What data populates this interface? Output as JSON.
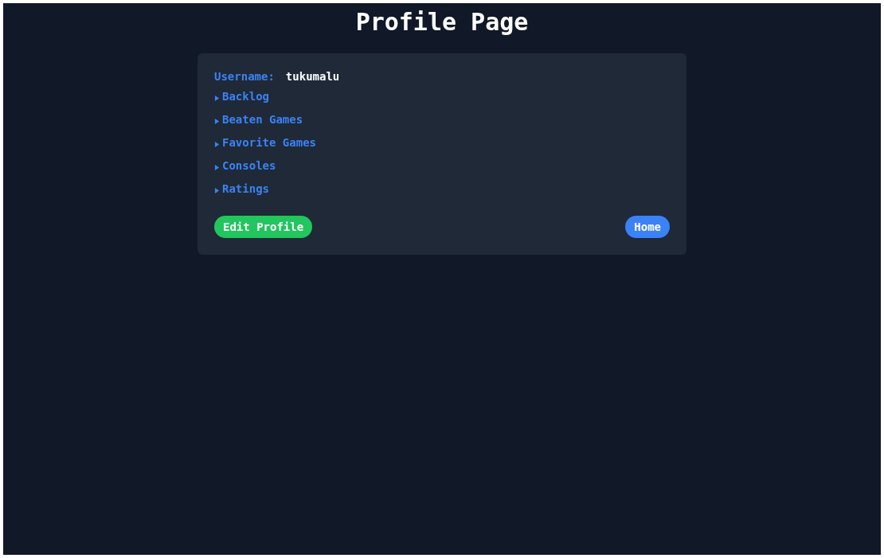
{
  "page": {
    "title": "Profile Page"
  },
  "profile": {
    "username_label": "Username:",
    "username": "tukumalu",
    "sections": [
      {
        "label": "Backlog",
        "expanded": false
      },
      {
        "label": "Beaten Games",
        "expanded": false
      },
      {
        "label": "Favorite Games",
        "expanded": false
      },
      {
        "label": "Consoles",
        "expanded": false
      },
      {
        "label": "Ratings",
        "expanded": false
      }
    ],
    "buttons": [
      {
        "label": "Edit Profile",
        "kind": "edit"
      },
      {
        "label": "Home",
        "kind": "home"
      }
    ]
  }
}
